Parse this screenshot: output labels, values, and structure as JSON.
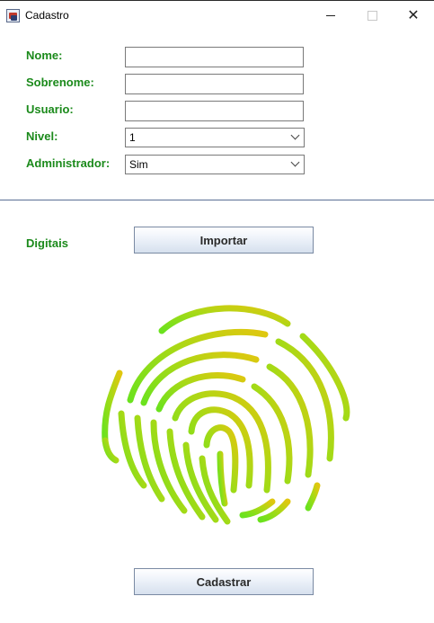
{
  "window": {
    "title": "Cadastro",
    "close_glyph": "✕"
  },
  "form": {
    "nome_label": "Nome:",
    "nome_value": "",
    "sobrenome_label": "Sobrenome:",
    "sobrenome_value": "",
    "usuario_label": "Usuario:",
    "usuario_value": "",
    "nivel_label": "Nivel:",
    "nivel_value": "1",
    "administrador_label": "Administrador:",
    "administrador_value": "Sim"
  },
  "fingerprint": {
    "label": "Digitais",
    "import_button": "Importar",
    "image_icon": "fingerprint-icon",
    "gradient_colors": [
      "#6be21e",
      "#a8d916",
      "#e0c70f"
    ]
  },
  "actions": {
    "submit_button": "Cadastrar"
  }
}
